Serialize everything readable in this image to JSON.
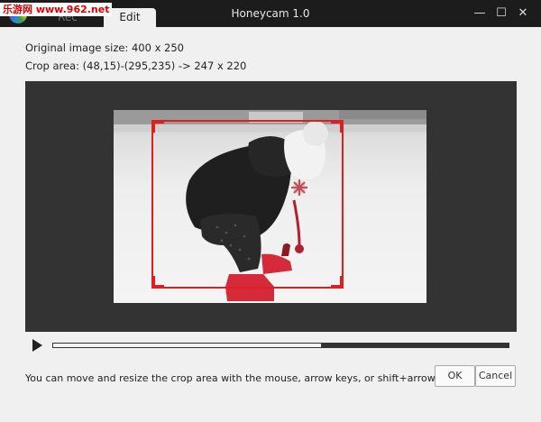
{
  "watermark": "乐游网 www.962.net",
  "titlebar": {
    "title": "Honeycam 1.0",
    "tabs": [
      {
        "label": "Rec"
      },
      {
        "label": "Edit"
      }
    ],
    "controls": {
      "minimize": "—",
      "maximize": "☐",
      "close": "✕"
    }
  },
  "info": {
    "original_size": "Original image size: 400 x 250",
    "crop_area": "Crop area: (48,15)-(295,235) -> 247 x 220"
  },
  "playback": {
    "progress": 0.59
  },
  "hint": "You can move and resize the crop area with the mouse, arrow keys, or shift+arrow keys.",
  "buttons": {
    "ok": "OK",
    "cancel": "Cancel"
  },
  "colors": {
    "crop_border": "#e01e1e",
    "canvas_bg": "#333333"
  }
}
